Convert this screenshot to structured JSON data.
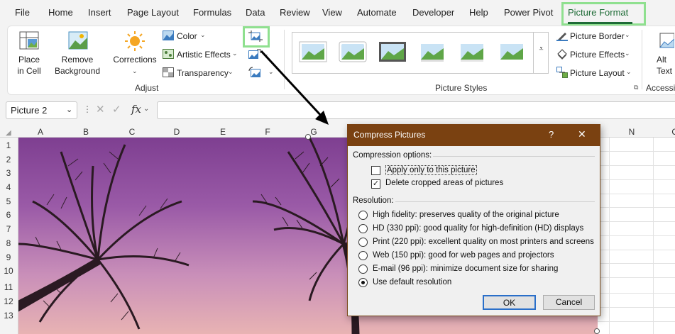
{
  "menu": {
    "tabs": [
      "File",
      "Home",
      "Insert",
      "Page Layout",
      "Formulas",
      "Data",
      "Review",
      "View",
      "Automate",
      "Developer",
      "Help",
      "Power Pivot",
      "Picture Format"
    ],
    "active_tab": "Picture Format"
  },
  "ribbon": {
    "place_in_cell": "Place\nin Cell",
    "remove_background": "Remove\nBackground",
    "corrections": "Corrections",
    "color": "Color",
    "artistic_effects": "Artistic Effects",
    "transparency": "Transparency",
    "adjust_label": "Adjust",
    "picture_styles_label": "Picture Styles",
    "picture_border": "Picture Border",
    "picture_effects": "Picture Effects",
    "picture_layout": "Picture Layout",
    "alt_text": "Alt\nText",
    "accessibility_label": "Accessib"
  },
  "formula_bar": {
    "name_box": "Picture 2",
    "fx": "fx",
    "formula": ""
  },
  "grid": {
    "columns": [
      "A",
      "B",
      "C",
      "D",
      "E",
      "F",
      "G",
      "N"
    ],
    "rows": [
      "1",
      "2",
      "3",
      "4",
      "5",
      "6",
      "7",
      "8",
      "9",
      "10",
      "11",
      "12",
      "13"
    ],
    "partial_col": "O"
  },
  "dialog": {
    "title": "Compress Pictures",
    "help": "?",
    "close": "✕",
    "compression_options_label": "Compression options:",
    "apply_only_label": "Apply only to this picture",
    "apply_only_checked": false,
    "delete_cropped_label": "Delete cropped areas of pictures",
    "delete_cropped_checked": true,
    "resolution_label": "Resolution:",
    "resolutions": [
      {
        "label": "High fidelity: preserves quality of the original picture",
        "selected": false
      },
      {
        "label": "HD (330 ppi): good quality for high-definition (HD) displays",
        "selected": false
      },
      {
        "label": "Print (220 ppi): excellent quality on most printers and screens",
        "selected": false
      },
      {
        "label": "Web (150 ppi): good for web pages and projectors",
        "selected": false
      },
      {
        "label": "E-mail (96 ppi): minimize document size for sharing",
        "selected": false
      },
      {
        "label": "Use default resolution",
        "selected": true
      }
    ],
    "ok": "OK",
    "cancel": "Cancel"
  },
  "colors": {
    "highlight": "#8fe08f",
    "accent_green": "#1e6b36",
    "dialog_title_bg": "#7a4111"
  }
}
